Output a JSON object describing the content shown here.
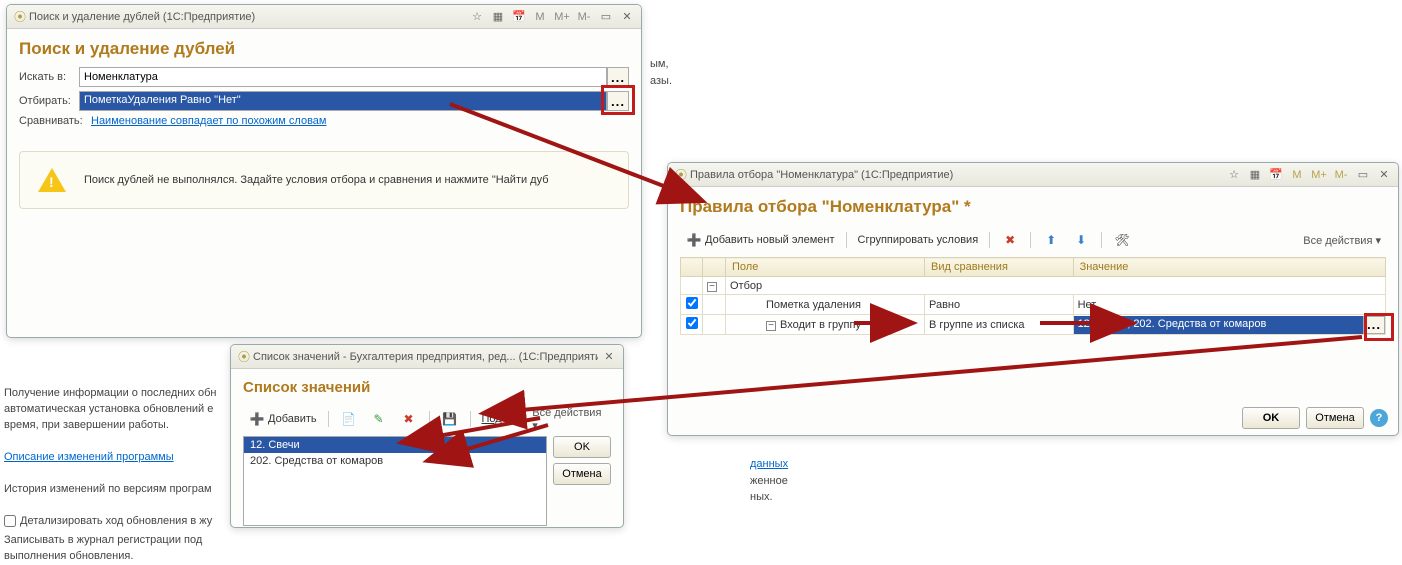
{
  "bg": {
    "info1": "Получение информации о последних обн",
    "info2": "автоматическая установка обновлений е",
    "info3": "время, при завершении работы.",
    "link_changes": "Описание изменений программы",
    "history": "История изменений по версиям програм",
    "detail_check": "Детализировать ход обновления в жу",
    "log1": "Записывать в журнал регистрации под",
    "log2": "выполнения обновления.",
    "frag_ym": "ым,",
    "frag_azy": "азы.",
    "frag_data": "данных",
    "frag_zhennoe": "женное",
    "frag_nyh": "ных."
  },
  "win1": {
    "title": "Поиск и удаление дублей  (1С:Предприятие)",
    "hdr": "Поиск и удаление дублей",
    "lbl_search": "Искать в:",
    "val_search": "Номенклатура",
    "lbl_filter": "Отбирать:",
    "val_filter": "ПометкаУдаления Равно \"Нет\"",
    "lbl_compare": "Сравнивать:",
    "link_compare": "Наименование совпадает по похожим словам",
    "info": "Поиск дублей не выполнялся.  Задайте условия отбора и сравнения и нажмите \"Найти дуб"
  },
  "win2": {
    "title": "Правила отбора \"Номенклатура\"  (1С:Предприятие)",
    "hdr": "Правила отбора \"Номенклатура\" *",
    "add_label": "Добавить новый элемент",
    "group_label": "Сгруппировать условия",
    "all_actions": "Все действия ▾",
    "cols": {
      "field": "Поле",
      "cmp": "Вид сравнения",
      "val": "Значение"
    },
    "rows": {
      "r0": {
        "field": "Отбор"
      },
      "r1": {
        "field": "Пометка удаления",
        "cmp": "Равно",
        "val": "Нет"
      },
      "r2": {
        "field": "Входит в группу",
        "cmp": "В группе из списка",
        "val": "12. Свечи; 202. Средства от комаров"
      }
    },
    "ok": "OK",
    "cancel": "Отмена"
  },
  "win3": {
    "title": "Список значений - Бухгалтерия предприятия, ред...  (1С:Предприятие)",
    "hdr": "Список значений",
    "add_label": "Добавить",
    "pick_label": "Подбор",
    "all_actions": "Все действия ▾",
    "items": {
      "i0": "12. Свечи",
      "i1": "202. Средства от комаров"
    },
    "ok": "OK",
    "cancel": "Отмена"
  }
}
